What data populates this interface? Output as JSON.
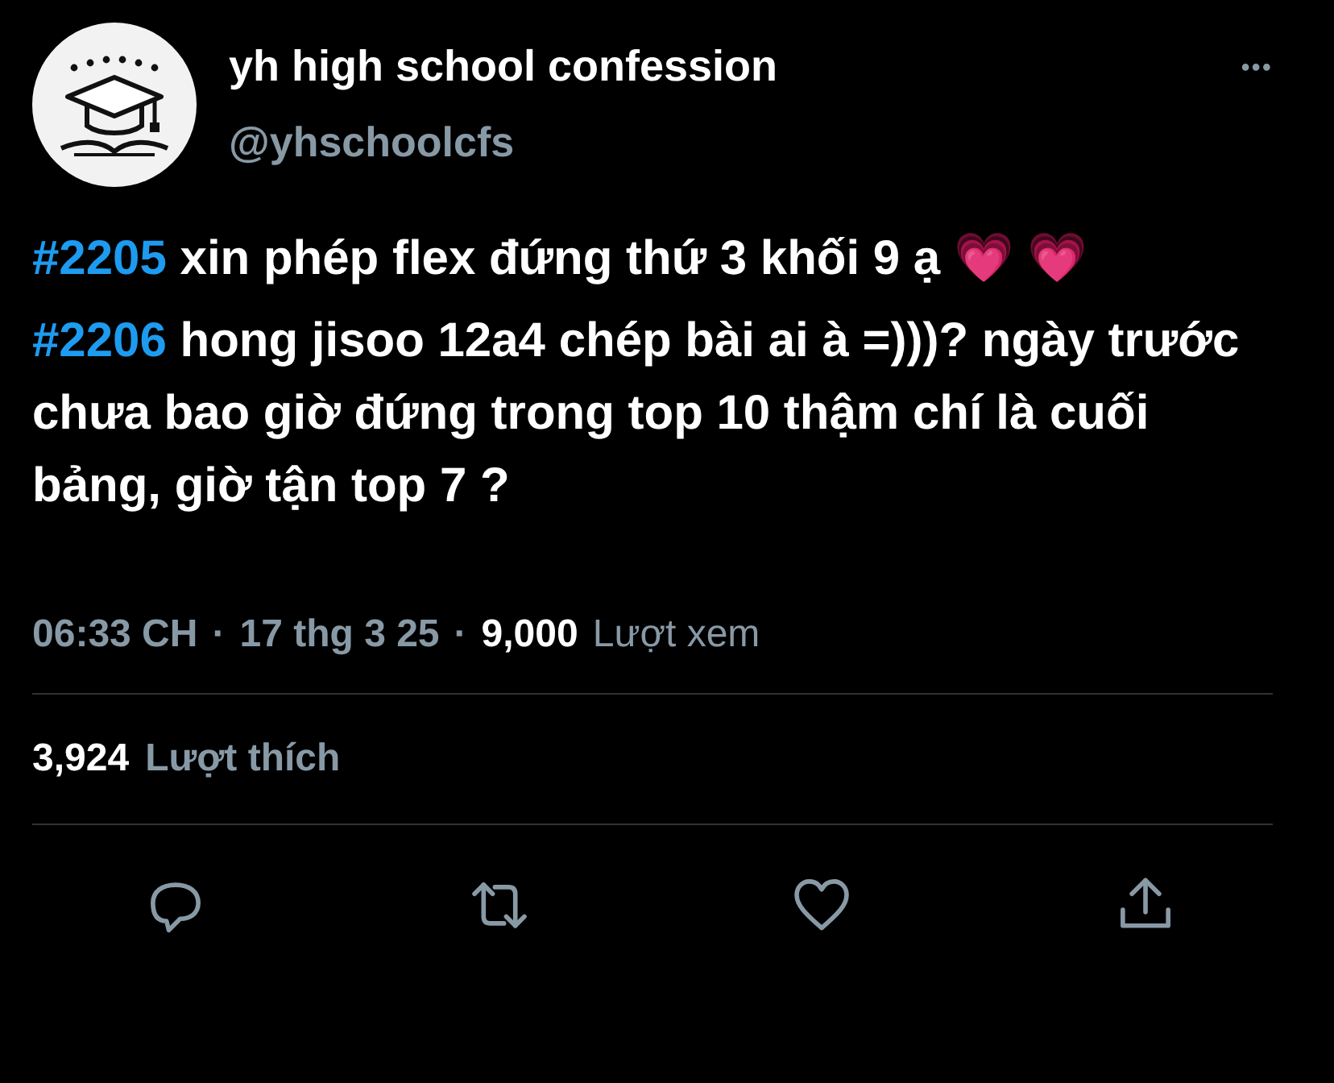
{
  "author": {
    "name": "yh high school confession",
    "handle": "@yhschoolcfs"
  },
  "more_menu": "•••",
  "posts": [
    {
      "hashtag": "#2205",
      "text": " xin phép flex đứng thứ 3 khối 9 ạ 💗 💗"
    },
    {
      "hashtag": "#2206",
      "text": " hong jisoo 12a4 chép bài ai à =)))? ngày trước chưa bao giờ đứng trong top 10 thậm chí là cuối bảng, giờ tận top 7 ?"
    }
  ],
  "meta": {
    "time": "06:33 CH",
    "separator_1": "·",
    "date": "17 thg 3 25",
    "separator_2": "·",
    "views": "9,000",
    "views_label": "Lượt xem"
  },
  "likes": {
    "count": "3,924",
    "label": "Lượt thích"
  },
  "actions": [
    {
      "kind": "reply"
    },
    {
      "kind": "retweet"
    },
    {
      "kind": "like"
    },
    {
      "kind": "share"
    }
  ]
}
